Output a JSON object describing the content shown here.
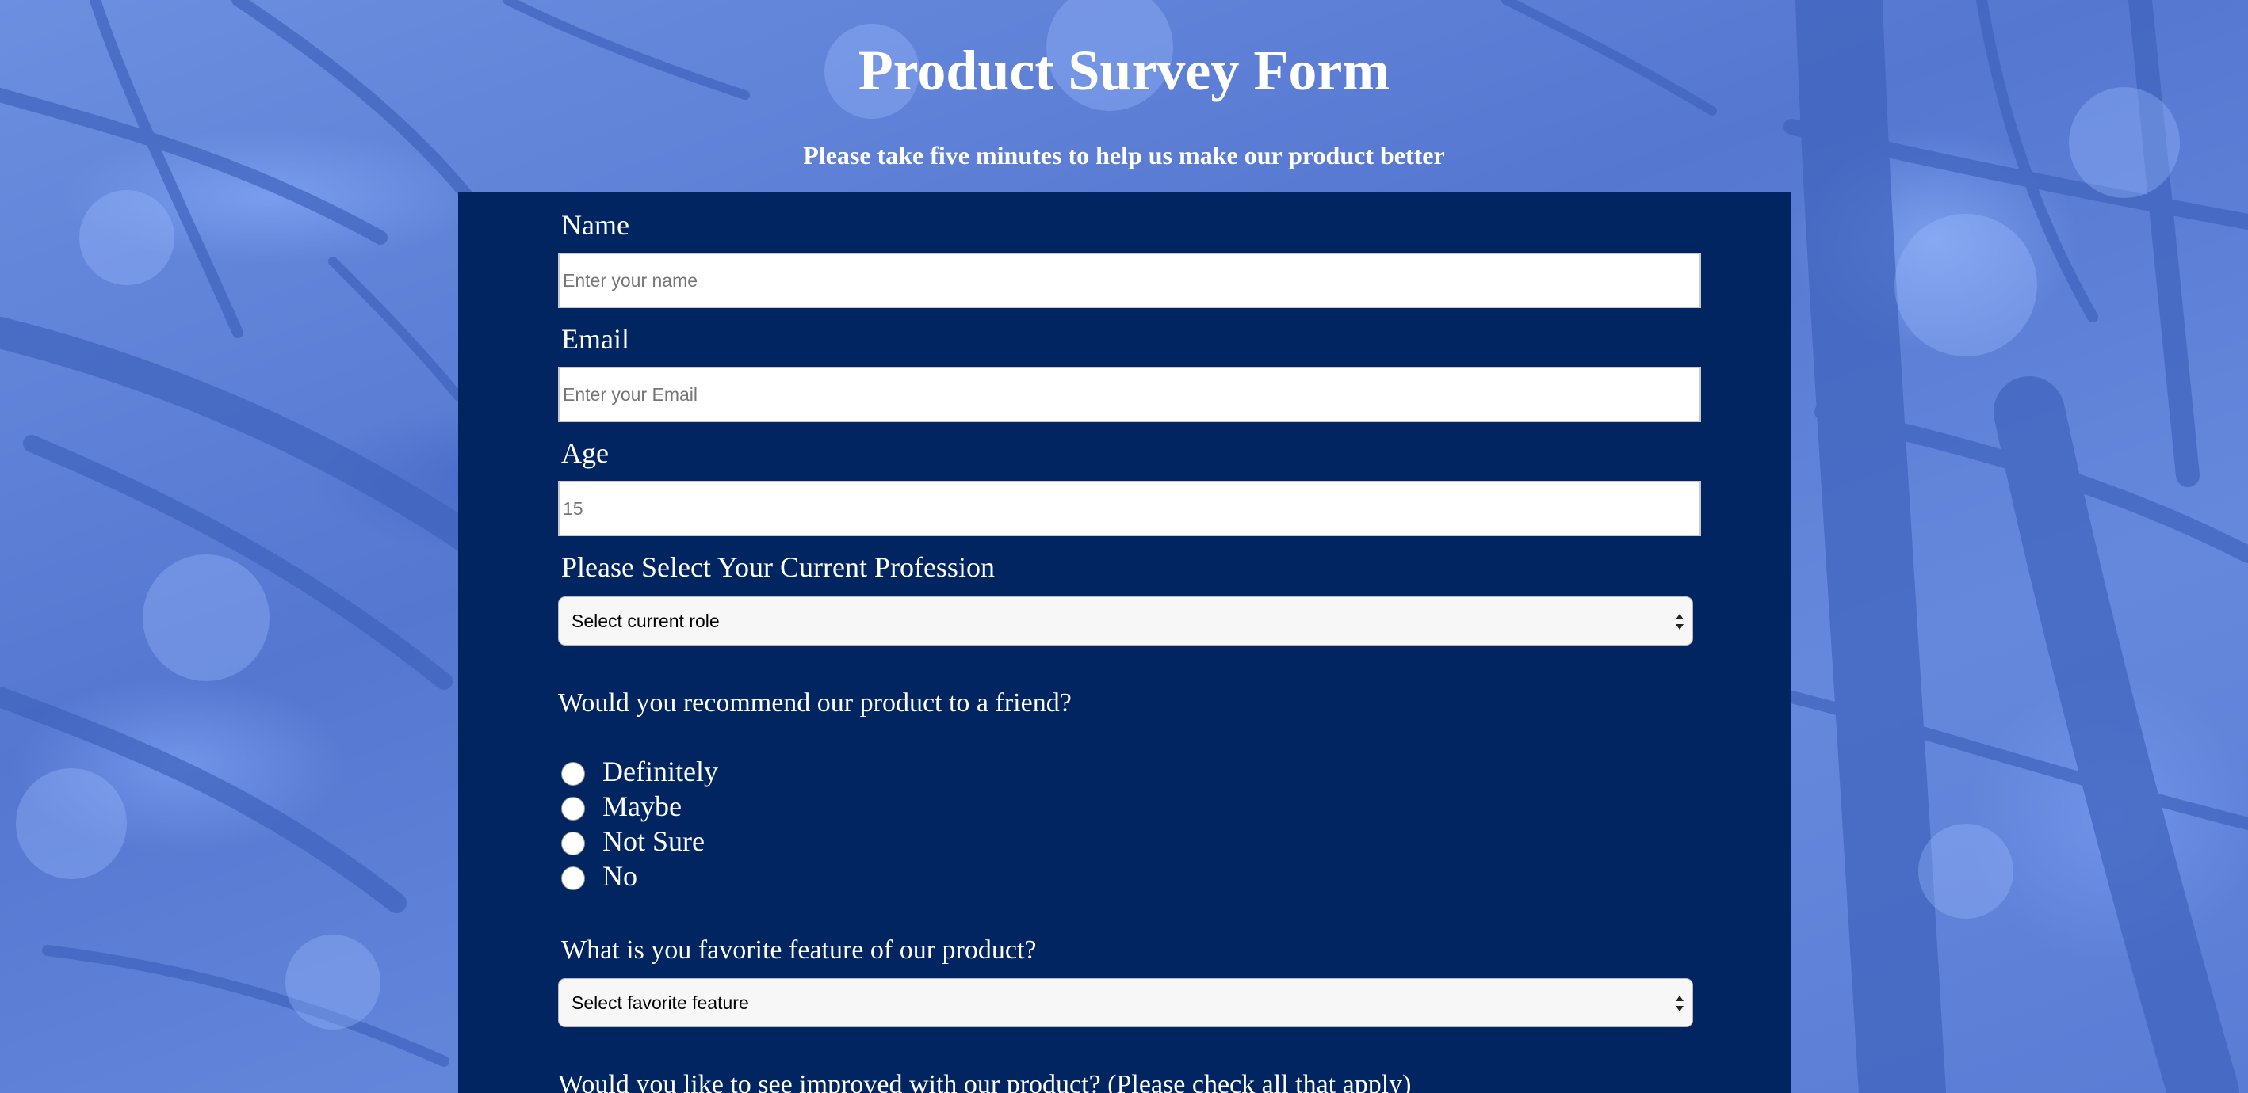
{
  "page": {
    "title": "Product Survey Form",
    "description": "Please take five minutes to help us make our product better"
  },
  "form": {
    "name": {
      "label": "Name",
      "placeholder": "Enter your name",
      "value": ""
    },
    "email": {
      "label": "Email",
      "placeholder": "Enter your Email",
      "value": ""
    },
    "age": {
      "label": "Age",
      "placeholder": "15",
      "value": ""
    },
    "profession": {
      "label": "Please Select Your Current Profession",
      "selected": "Select current role"
    },
    "recommend": {
      "question": "Would you recommend our product to a friend?",
      "options": [
        {
          "label": "Definitely",
          "checked": false
        },
        {
          "label": "Maybe",
          "checked": false
        },
        {
          "label": "Not Sure",
          "checked": false
        },
        {
          "label": "No",
          "checked": false
        }
      ]
    },
    "favorite_feature": {
      "label": "What is you favorite feature of our product?",
      "selected": "Select favorite feature"
    },
    "improvements": {
      "question": "Would you like to see improved with our product? (Please check all that apply)"
    }
  },
  "colors": {
    "background": "#5b7fd6",
    "panel": "#002561",
    "text": "#ffffff"
  }
}
